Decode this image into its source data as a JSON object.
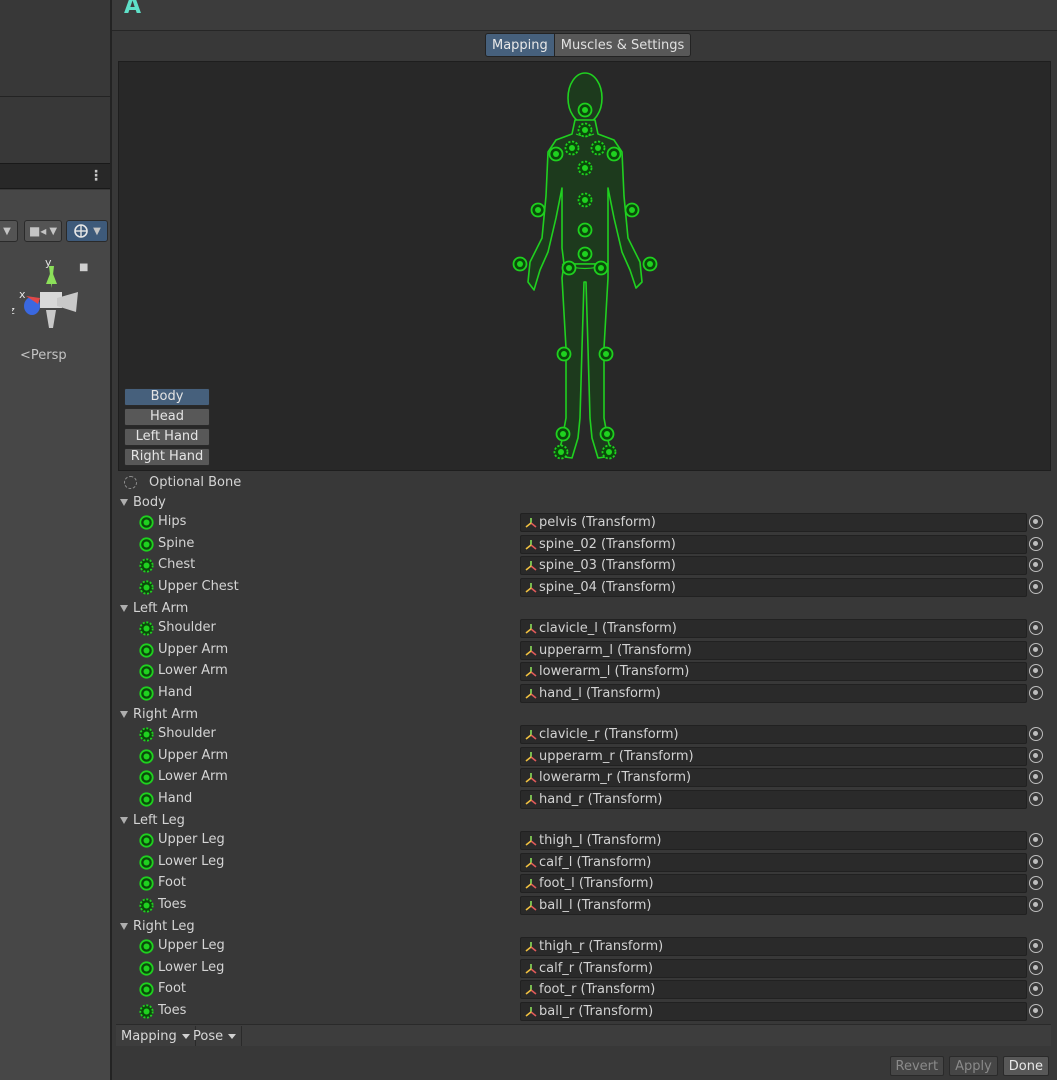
{
  "scene": {
    "axis_y": "y",
    "axis_x": "x",
    "axis_z": "z",
    "persp_label": "<Persp"
  },
  "inspector": {
    "tabs": [
      {
        "label": "Mapping",
        "active": true
      },
      {
        "label": "Muscles & Settings",
        "active": false
      }
    ],
    "region_buttons": [
      {
        "label": "Body",
        "active": true
      },
      {
        "label": "Head",
        "active": false
      },
      {
        "label": "Left Hand",
        "active": false
      },
      {
        "label": "Right Hand",
        "active": false
      }
    ],
    "optional_bone_label": "Optional Bone",
    "groups": [
      {
        "name": "Body",
        "bones": [
          {
            "label": "Hips",
            "value": "pelvis (Transform)",
            "optional": false
          },
          {
            "label": "Spine",
            "value": "spine_02 (Transform)",
            "optional": false
          },
          {
            "label": "Chest",
            "value": "spine_03 (Transform)",
            "optional": true
          },
          {
            "label": "Upper Chest",
            "value": "spine_04 (Transform)",
            "optional": true
          }
        ]
      },
      {
        "name": "Left Arm",
        "bones": [
          {
            "label": "Shoulder",
            "value": "clavicle_l (Transform)",
            "optional": true
          },
          {
            "label": "Upper Arm",
            "value": "upperarm_l (Transform)",
            "optional": false
          },
          {
            "label": "Lower Arm",
            "value": "lowerarm_l (Transform)",
            "optional": false
          },
          {
            "label": "Hand",
            "value": "hand_l (Transform)",
            "optional": false
          }
        ]
      },
      {
        "name": "Right Arm",
        "bones": [
          {
            "label": "Shoulder",
            "value": "clavicle_r (Transform)",
            "optional": true
          },
          {
            "label": "Upper Arm",
            "value": "upperarm_r (Transform)",
            "optional": false
          },
          {
            "label": "Lower Arm",
            "value": "lowerarm_r (Transform)",
            "optional": false
          },
          {
            "label": "Hand",
            "value": "hand_r (Transform)",
            "optional": false
          }
        ]
      },
      {
        "name": "Left Leg",
        "bones": [
          {
            "label": "Upper Leg",
            "value": "thigh_l (Transform)",
            "optional": false
          },
          {
            "label": "Lower Leg",
            "value": "calf_l (Transform)",
            "optional": false
          },
          {
            "label": "Foot",
            "value": "foot_l (Transform)",
            "optional": false
          },
          {
            "label": "Toes",
            "value": "ball_l (Transform)",
            "optional": true
          }
        ]
      },
      {
        "name": "Right Leg",
        "bones": [
          {
            "label": "Upper Leg",
            "value": "thigh_r (Transform)",
            "optional": false
          },
          {
            "label": "Lower Leg",
            "value": "calf_r (Transform)",
            "optional": false
          },
          {
            "label": "Foot",
            "value": "foot_r (Transform)",
            "optional": false
          },
          {
            "label": "Toes",
            "value": "ball_r (Transform)",
            "optional": true
          }
        ]
      }
    ],
    "bottom_toolbar": {
      "mapping_label": "Mapping",
      "pose_label": "Pose"
    },
    "footer": {
      "revert_label": "Revert",
      "apply_label": "Apply",
      "done_label": "Done"
    }
  },
  "colors": {
    "bone_green": "#1fd11f",
    "bone_fill": "#0a4a0a",
    "active_blue": "#46607c"
  }
}
